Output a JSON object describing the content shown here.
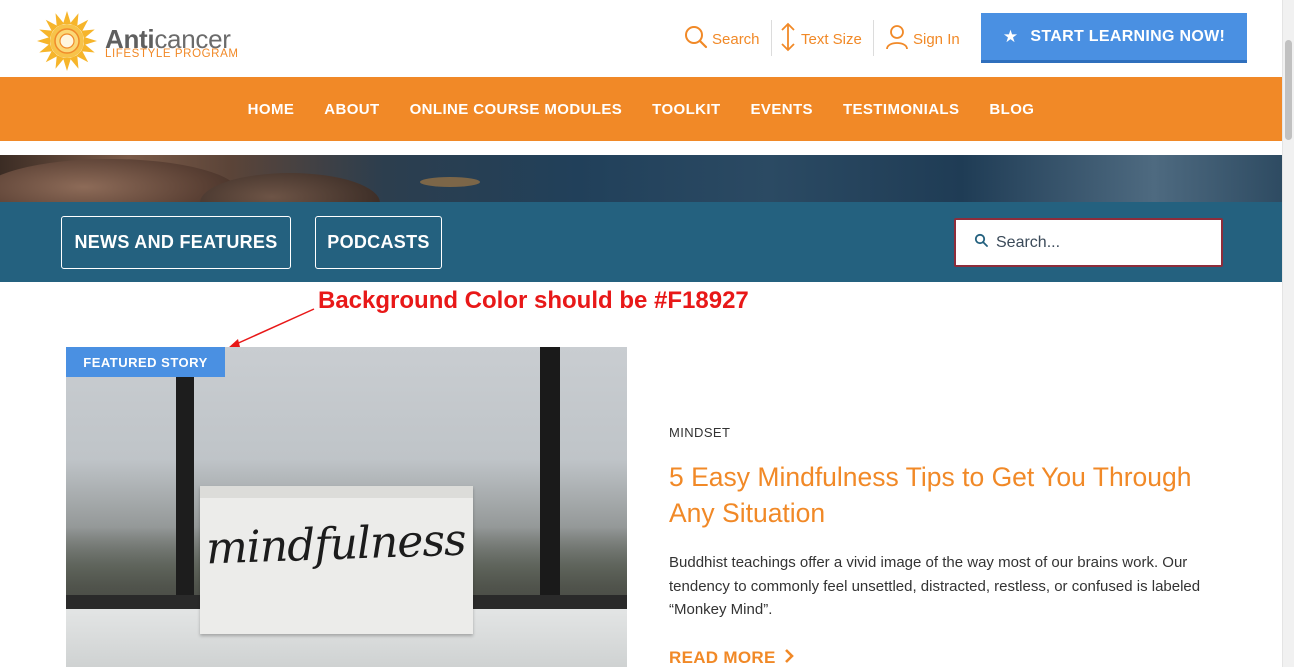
{
  "header": {
    "logo": {
      "name_bold": "Anti",
      "name_rest": "cancer",
      "subtitle": "LIFESTYLE PROGRAM"
    },
    "utilities": {
      "search": "Search",
      "text_size": "Text Size",
      "sign_in": "Sign In"
    },
    "cta": "START LEARNING NOW!"
  },
  "nav": {
    "items": [
      {
        "label": "HOME"
      },
      {
        "label": "ABOUT"
      },
      {
        "label": "ONLINE COURSE MODULES"
      },
      {
        "label": "TOOLKIT"
      },
      {
        "label": "EVENTS"
      },
      {
        "label": "TESTIMONIALS"
      },
      {
        "label": "BLOG"
      }
    ]
  },
  "subbar": {
    "tabs": [
      {
        "label": "NEWS AND FEATURES"
      },
      {
        "label": "PODCASTS"
      }
    ],
    "search_placeholder": "Search..."
  },
  "annotation": {
    "text": "Background Color should be #F18927",
    "color": "#E81818"
  },
  "featured": {
    "badge": "FEATURED STORY",
    "image_word": "mindfulness",
    "category": "MINDSET",
    "title": "5 Easy Mindfulness Tips to Get You Through Any Situation",
    "excerpt": "Buddhist teachings offer a vivid image of the way most of our brains work. Our tendency to commonly feel unsettled, distracted, restless, or confused is labeled “Monkey Mind”.",
    "read_more": "READ MORE"
  },
  "colors": {
    "brand_orange": "#F18927",
    "cta_blue": "#4A90E2",
    "subbar_teal": "#24617F",
    "search_border": "#8E2D3B"
  }
}
